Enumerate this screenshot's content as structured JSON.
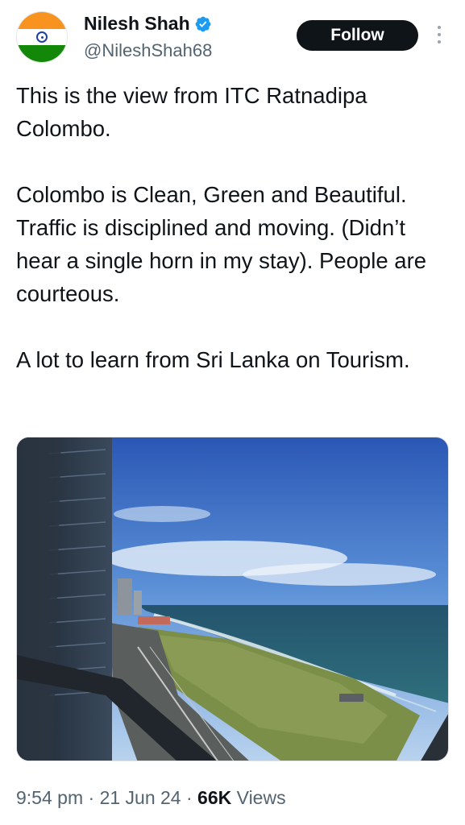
{
  "author": {
    "name": "Nilesh Shah",
    "handle": "@NileshShah68",
    "avatar_icon": "india-flag-icon",
    "verified_icon": "verified-badge-icon",
    "verified_color": "#1d9bf0"
  },
  "follow_label": "Follow",
  "more_icon": "more-vertical-icon",
  "tweet": {
    "paragraphs": [
      "This is the view from ITC Ratnadipa Colombo.",
      "Colombo is Clean, Green and Beautiful. Traffic is disciplined and moving. (Didn’t hear a single horn in my stay). People are courteous.",
      "A lot to learn from Sri Lanka on Tourism."
    ]
  },
  "media": {
    "alt": "Photo"
  },
  "meta": {
    "time": "9:54 pm",
    "sep1": " · ",
    "date": "21 Jun 24",
    "sep2": " · ",
    "views_count": "66K",
    "views_label": " Views"
  },
  "colors": {
    "text": "#0f1419",
    "secondary": "#536471",
    "follow_bg": "#0f1419",
    "follow_text": "#ffffff"
  }
}
